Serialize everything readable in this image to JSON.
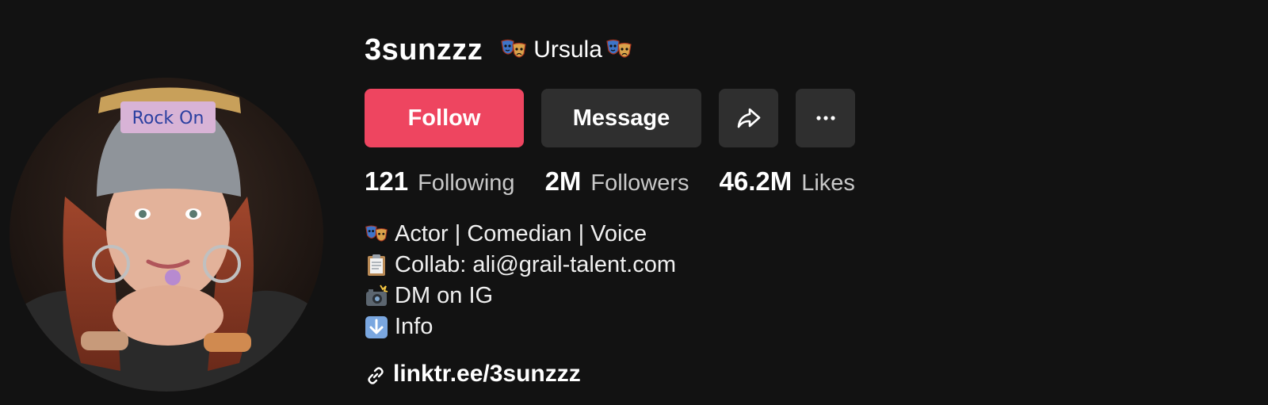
{
  "profile": {
    "username": "3sunzzz",
    "nickname": "Ursula",
    "nickname_icon": "performing-arts-masks-icon"
  },
  "actions": {
    "follow_label": "Follow",
    "message_label": "Message",
    "share_icon": "share-arrow-icon",
    "more_icon": "more-dots-icon"
  },
  "stats": [
    {
      "value": "121",
      "label": "Following"
    },
    {
      "value": "2M",
      "label": "Followers"
    },
    {
      "value": "46.2M",
      "label": "Likes"
    }
  ],
  "bio": [
    {
      "icon": "performing-arts-masks-icon",
      "text": "Actor | Comedian | Voice"
    },
    {
      "icon": "clipboard-icon",
      "text": "Collab: ali@grail-talent.com"
    },
    {
      "icon": "camera-flash-icon",
      "text": "DM on IG"
    },
    {
      "icon": "down-arrow-icon",
      "text": "Info"
    }
  ],
  "link": {
    "icon": "link-icon",
    "text": "linktr.ee/3sunzzz"
  },
  "colors": {
    "background": "#121212",
    "follow_button": "#ee4560",
    "secondary_button": "#2f2f2f",
    "stat_label": "#c9c9c9"
  }
}
